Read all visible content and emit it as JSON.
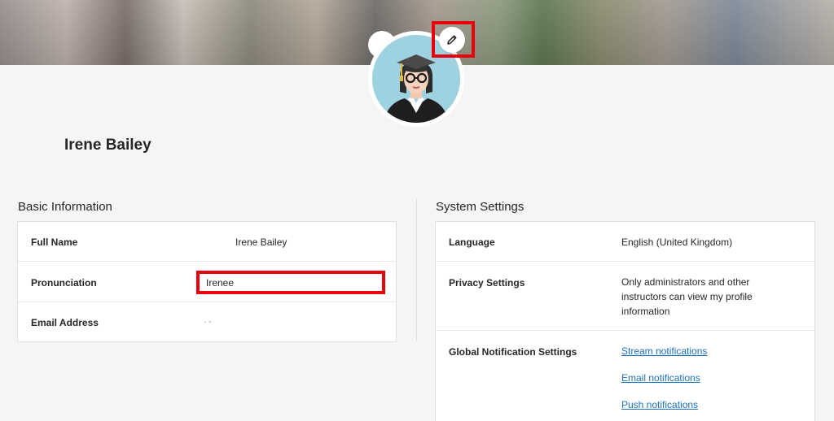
{
  "profile": {
    "name": "Irene Bailey"
  },
  "basic_information": {
    "title": "Basic Information",
    "full_name_label": "Full Name",
    "full_name_value": "Irene Bailey",
    "pronunciation_label": "Pronunciation",
    "pronunciation_value": "Irenee",
    "email_label": "Email Address",
    "email_value": "  ·      -"
  },
  "system_settings": {
    "title": "System Settings",
    "language_label": "Language",
    "language_value": "English (United Kingdom)",
    "privacy_label": "Privacy Settings",
    "privacy_value": "Only administrators and other instructors can view my profile information",
    "notifications_label": "Global Notification Settings",
    "links": [
      "Stream notifications",
      "Email notifications",
      "Push notifications"
    ]
  },
  "colors": {
    "highlight": "#e8000d",
    "link": "#1d70b8",
    "avatar_bg": "#9fd2e0"
  },
  "icons": {
    "edit": "pencil-icon",
    "avatar": "graduate-avatar"
  }
}
